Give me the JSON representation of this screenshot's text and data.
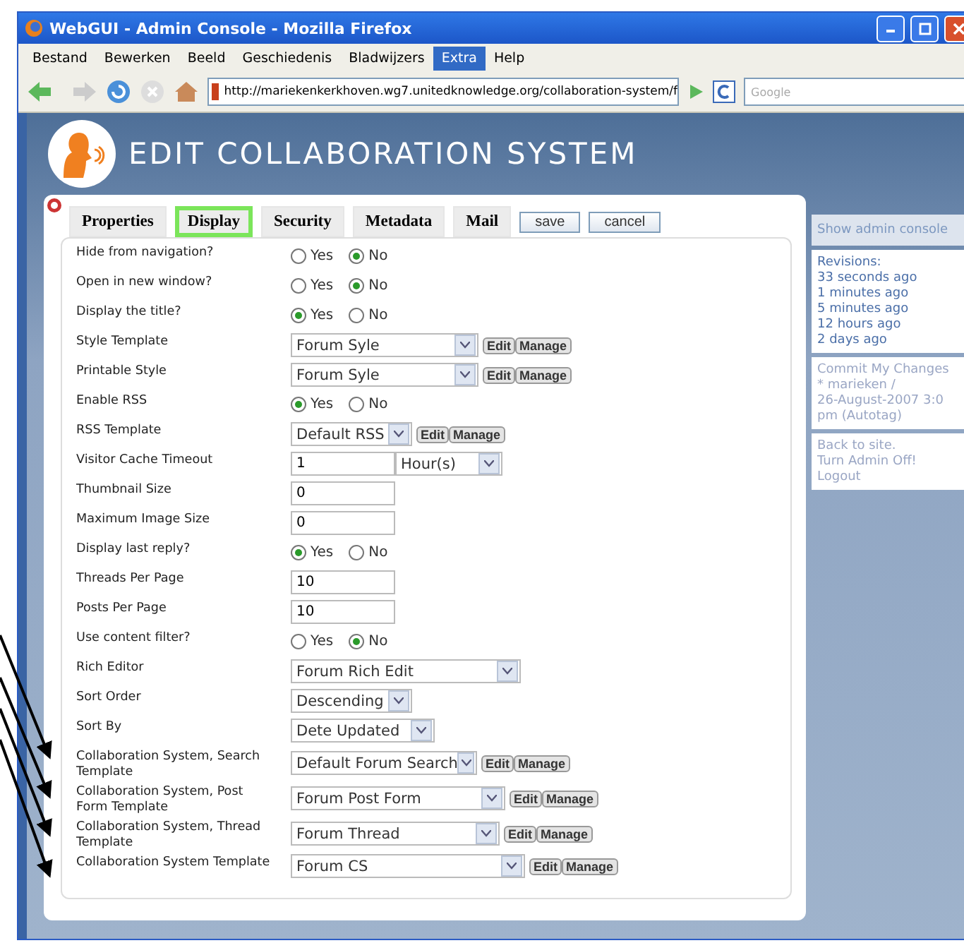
{
  "window": {
    "title": "WebGUI - Admin Console - Mozilla Firefox"
  },
  "menu": [
    {
      "label": "Bestand",
      "selected": false
    },
    {
      "label": "Bewerken",
      "selected": false
    },
    {
      "label": "Beeld",
      "selected": false
    },
    {
      "label": "Geschiedenis",
      "selected": false
    },
    {
      "label": "Bladwijzers",
      "selected": false
    },
    {
      "label": "Extra",
      "selected": true
    },
    {
      "label": "Help",
      "selected": false
    }
  ],
  "toolbar": {
    "url": "http://mariekenkerkhoven.wg7.unitedknowledge.org/collaboration-system/f",
    "search_placeholder": "Google"
  },
  "page_title": "EDIT COLLABORATION SYSTEM",
  "tabs": [
    {
      "label": "Properties",
      "selected": false
    },
    {
      "label": "Display",
      "selected": true
    },
    {
      "label": "Security",
      "selected": false
    },
    {
      "label": "Metadata",
      "selected": false
    },
    {
      "label": "Mail",
      "selected": false
    }
  ],
  "actions": [
    "save",
    "cancel"
  ],
  "rows": [
    {
      "label": "Hide from navigation?",
      "kind": "radio",
      "options": [
        {
          "label": "Yes",
          "selected": false
        },
        {
          "label": "No",
          "selected": true
        }
      ]
    },
    {
      "label": "Open in new window?",
      "kind": "radio",
      "options": [
        {
          "label": "Yes",
          "selected": false
        },
        {
          "label": "No",
          "selected": true
        }
      ]
    },
    {
      "label": "Display the title?",
      "kind": "radio",
      "options": [
        {
          "label": "Yes",
          "selected": true
        },
        {
          "label": "No",
          "selected": false
        }
      ]
    },
    {
      "label": "Style Template",
      "kind": "select",
      "value": "Forum Syle",
      "buttons": [
        "Edit",
        "Manage"
      ]
    },
    {
      "label": "Printable Style",
      "kind": "select",
      "value": "Forum Syle",
      "buttons": [
        "Edit",
        "Manage"
      ]
    },
    {
      "label": "Enable RSS",
      "kind": "radio",
      "options": [
        {
          "label": "Yes",
          "selected": true
        },
        {
          "label": "No",
          "selected": false
        }
      ]
    },
    {
      "label": "RSS Template",
      "kind": "select",
      "value": "Default RSS",
      "buttons": [
        "Edit",
        "Manage"
      ]
    },
    {
      "label": "Visitor Cache Timeout",
      "kind": "interval",
      "value": "1",
      "unit": "Hour(s)"
    },
    {
      "label": "Thumbnail Size",
      "kind": "text",
      "value": "0"
    },
    {
      "label": "Maximum Image Size",
      "kind": "text",
      "value": "0"
    },
    {
      "label": "Display last reply?",
      "kind": "radio",
      "options": [
        {
          "label": "Yes",
          "selected": true
        },
        {
          "label": "No",
          "selected": false
        }
      ]
    },
    {
      "label": "Threads Per Page",
      "kind": "text",
      "value": "10"
    },
    {
      "label": "Posts Per Page",
      "kind": "text",
      "value": "10"
    },
    {
      "label": "Use content filter?",
      "kind": "radio",
      "options": [
        {
          "label": "Yes",
          "selected": false
        },
        {
          "label": "No",
          "selected": true
        }
      ]
    },
    {
      "label": "Rich Editor",
      "kind": "select",
      "value": "Forum Rich Edit"
    },
    {
      "label": "Sort Order",
      "kind": "select",
      "value": "Descending"
    },
    {
      "label": "Sort By",
      "kind": "select",
      "value": "Dete Updated"
    },
    {
      "label": "Collaboration System, Search Template",
      "kind": "select",
      "value": "Default Forum Search",
      "buttons": [
        "Edit",
        "Manage"
      ]
    },
    {
      "label": "Collaboration System, Post Form Template",
      "kind": "select",
      "value": "Forum Post Form",
      "buttons": [
        "Edit",
        "Manage"
      ]
    },
    {
      "label": "Collaboration System, Thread Template",
      "kind": "select",
      "value": "Forum Thread",
      "buttons": [
        "Edit",
        "Manage"
      ]
    },
    {
      "label": "Collaboration System Template",
      "kind": "select",
      "value": "Forum CS",
      "buttons": [
        "Edit",
        "Manage"
      ]
    }
  ],
  "sidebar": {
    "header": "Show admin console",
    "revisions_title": "Revisions:",
    "revisions": [
      "33 seconds ago",
      "1 minutes ago",
      "5 minutes ago",
      "12 hours ago",
      "2 days ago"
    ],
    "commit": [
      "Commit My Changes",
      "* marieken /",
      "26-August-2007 3:0",
      "pm (Autotag)"
    ],
    "links": [
      "Back to site.",
      "Turn Admin Off!",
      "Logout"
    ]
  }
}
